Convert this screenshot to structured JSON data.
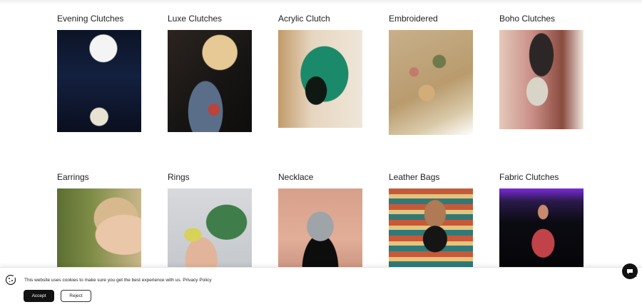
{
  "categories_row1": [
    {
      "title": "Evening Clutches",
      "image": "evening-clutches-photo"
    },
    {
      "title": "Luxe Clutches",
      "image": "luxe-clutches-photo"
    },
    {
      "title": "Acrylic Clutch",
      "image": "acrylic-clutch-photo"
    },
    {
      "title": "Embroidered",
      "image": "embroidered-photo"
    },
    {
      "title": "Boho Clutches",
      "image": "boho-clutches-photo"
    }
  ],
  "categories_row2": [
    {
      "title": "Earrings",
      "image": "earrings-photo"
    },
    {
      "title": "Rings",
      "image": "rings-photo"
    },
    {
      "title": "Necklace",
      "image": "necklace-photo"
    },
    {
      "title": "Leather Bags",
      "image": "leather-bags-photo"
    },
    {
      "title": "Fabric Clutches",
      "image": "fabric-clutches-photo"
    }
  ],
  "cookie_banner": {
    "message": "This website uses cookies to make sure you get the best experience with us.",
    "policy_link": "Privacy Policy",
    "accept_label": "Accept",
    "reject_label": "Reject",
    "close_label": "×",
    "icon": "cookie-icon"
  },
  "chat_widget": {
    "icon": "chat-icon"
  }
}
